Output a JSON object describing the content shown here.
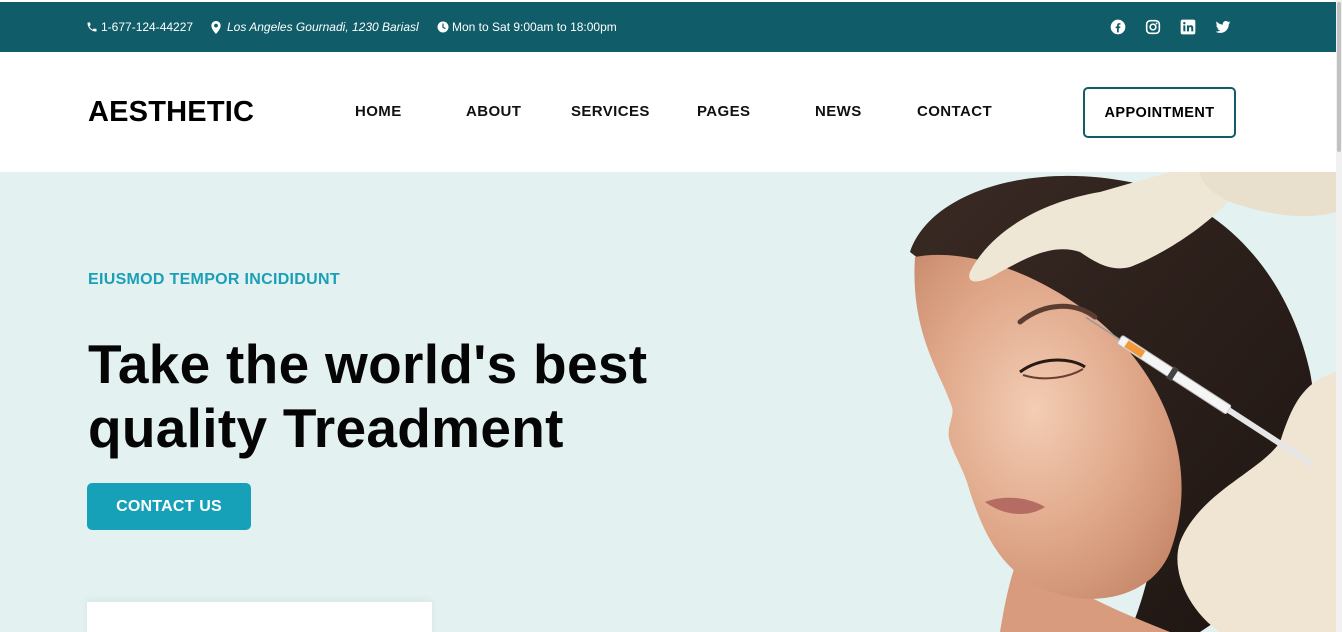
{
  "topbar": {
    "phone": "1-677-124-44227",
    "address": "Los Angeles Gournadi, 1230 Bariasl",
    "hours": "Mon to Sat 9:00am to 18:00pm",
    "social_icons": [
      "facebook-icon",
      "instagram-icon",
      "linkedin-icon",
      "twitter-icon"
    ],
    "bg_color": "#105c68"
  },
  "header": {
    "logo": "AESTHETIC",
    "nav": [
      "HOME",
      "ABOUT",
      "SERVICES",
      "PAGES",
      "NEWS",
      "CONTACT"
    ],
    "appointment_label": "APPOINTMENT"
  },
  "hero": {
    "subtitle": "EIUSMOD TEMPOR INCIDIDUNT",
    "title_line1": "Take the world's best",
    "title_line2": "quality Treadment",
    "cta_label": "CONTACT US",
    "accent_color": "#17a1b8",
    "bg_color": "#e3f2f1"
  }
}
